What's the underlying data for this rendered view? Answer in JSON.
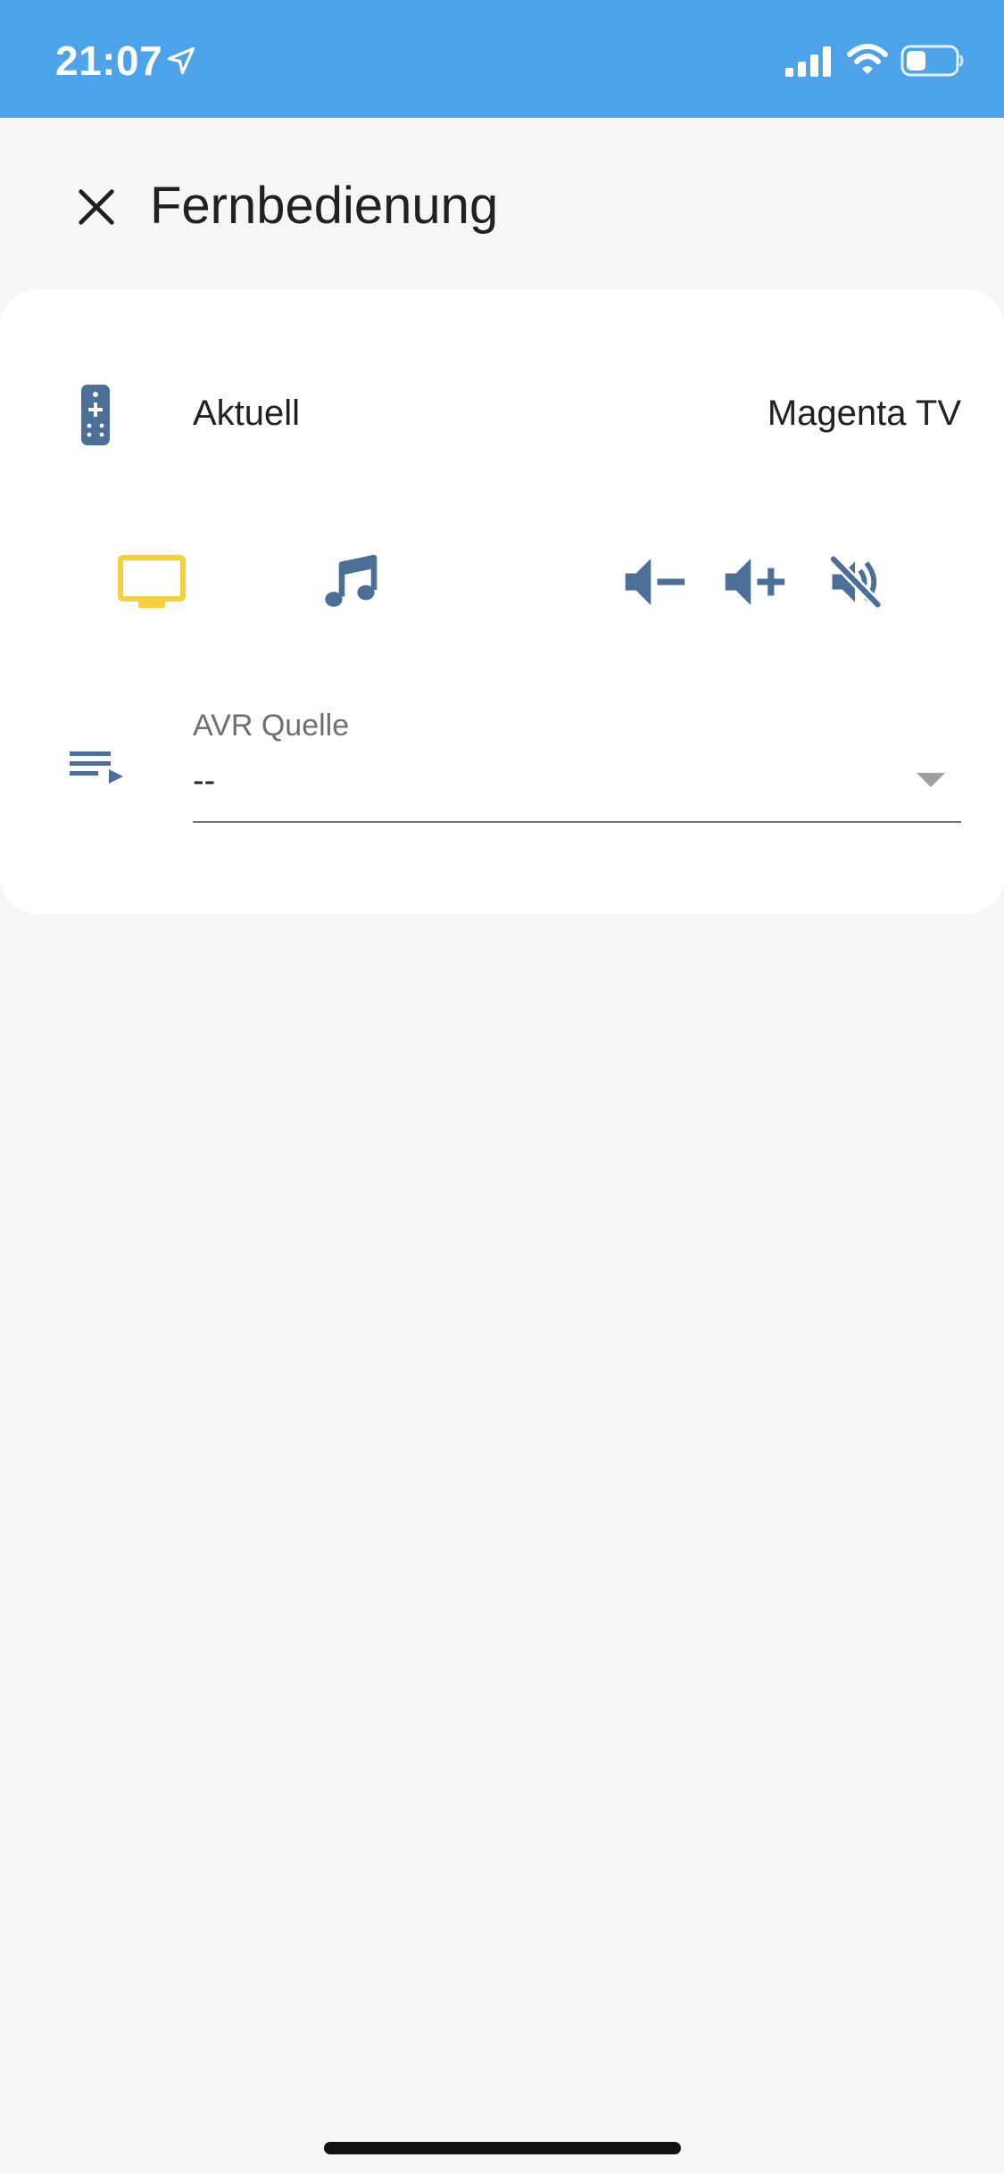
{
  "status_bar": {
    "time": "21:07",
    "background_color": "#4da3ea",
    "icons": [
      "location-arrow-icon",
      "cellular-signal-icon",
      "wifi-icon",
      "battery-icon"
    ]
  },
  "header": {
    "title": "Fernbedienung",
    "close_icon": "close-icon"
  },
  "card": {
    "current": {
      "icon": "remote-control-icon",
      "label": "Aktuell",
      "value": "Magenta TV"
    },
    "controls": [
      {
        "name": "tv",
        "icon": "tv-icon",
        "color": "#f4d03f",
        "active": true
      },
      {
        "name": "music",
        "icon": "music-note-icon",
        "color": "#4c6f97"
      },
      {
        "name": "volume-down",
        "icon": "volume-minus-icon",
        "color": "#4c6f97"
      },
      {
        "name": "volume-up",
        "icon": "volume-plus-icon",
        "color": "#4c6f97"
      },
      {
        "name": "mute",
        "icon": "volume-off-icon",
        "color": "#4c6f97"
      }
    ],
    "source": {
      "icon": "playlist-play-icon",
      "label": "AVR Quelle",
      "value": "--"
    }
  },
  "colors": {
    "accent_blue": "#4c6f97",
    "active_yellow": "#f4d03f",
    "header_blue": "#4da3ea",
    "background": "#f6f6f6"
  }
}
